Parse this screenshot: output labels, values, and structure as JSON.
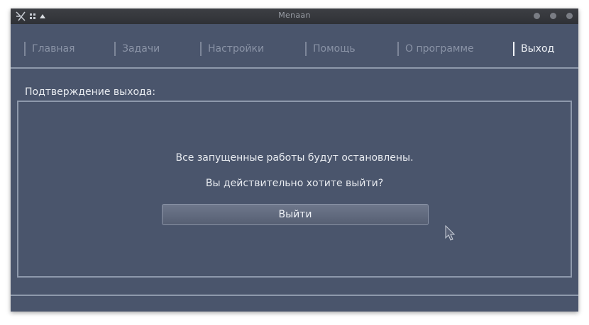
{
  "window": {
    "title": "Menaan"
  },
  "tabs": [
    {
      "label": "Главная"
    },
    {
      "label": "Задачи"
    },
    {
      "label": "Настройки"
    },
    {
      "label": "Помощь"
    },
    {
      "label": "О программе"
    },
    {
      "label": "Выход",
      "active": true
    }
  ],
  "exit": {
    "section_label": "Подтверждение выхода:",
    "message_line1": "Все запущенные работы будут остановлены.",
    "message_line2": "Вы действительно хотите выйти?",
    "button_label": "Выйти"
  },
  "colors": {
    "background": "#4a556c",
    "titlebar": "#2f3136",
    "border": "#8e99ac",
    "text": "#e8ebf0",
    "inactive_tab_text": "#8a93a6"
  },
  "icons": [
    "app-logo-icon",
    "menu-dots-icon",
    "arrow-up-icon",
    "minimize-icon",
    "maximize-icon",
    "close-icon",
    "mouse-pointer-icon"
  ]
}
